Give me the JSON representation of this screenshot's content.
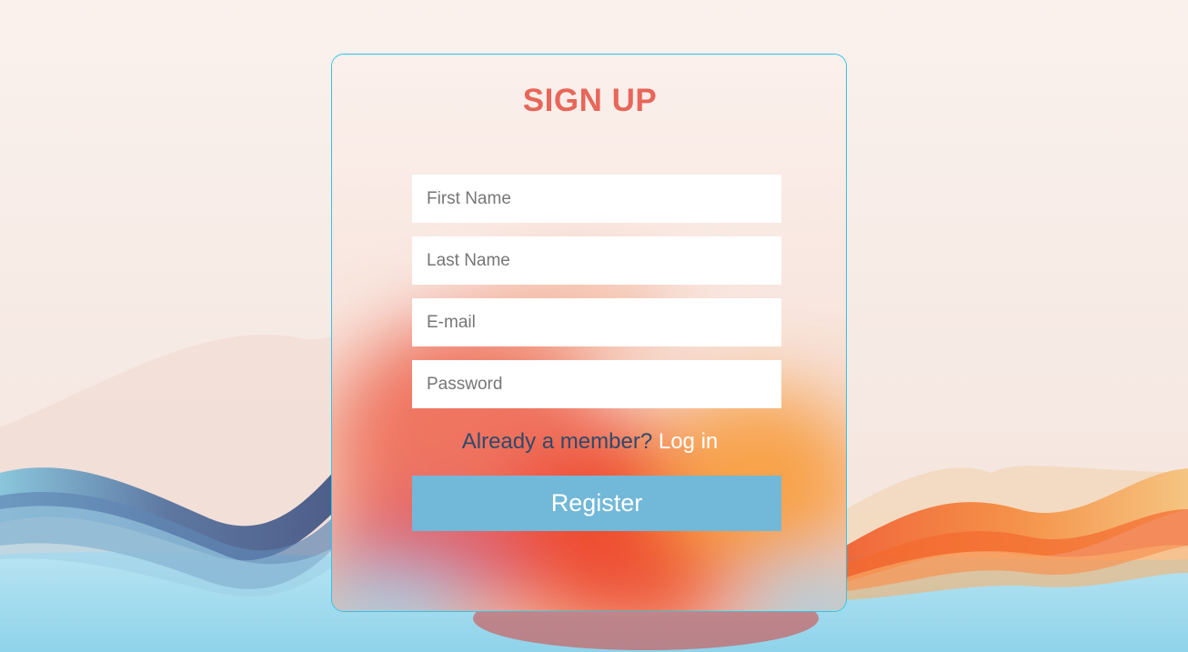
{
  "colors": {
    "accent_title": "#e8665a",
    "card_border": "#2fc4e8",
    "button_bg": "#72b8d8",
    "member_text": "#2f4a6b",
    "link": "#ffffff"
  },
  "form": {
    "title": "SIGN UP",
    "fields": {
      "first_name": {
        "placeholder": "First Name",
        "value": ""
      },
      "last_name": {
        "placeholder": "Last Name",
        "value": ""
      },
      "email": {
        "placeholder": "E-mail",
        "value": ""
      },
      "password": {
        "placeholder": "Password",
        "value": ""
      }
    },
    "member_prompt": "Already a member?",
    "login_link": "Log in",
    "register_label": "Register"
  }
}
